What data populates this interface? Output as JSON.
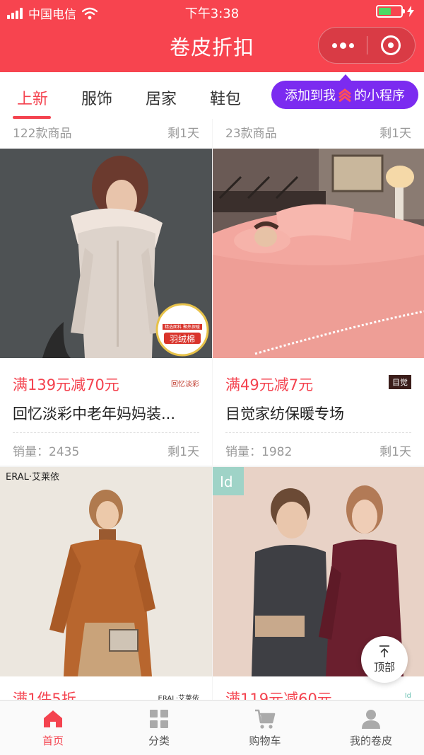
{
  "status_bar": {
    "carrier": "中国电信",
    "time": "下午3:38"
  },
  "header": {
    "title": "卷皮折扣"
  },
  "tabs": [
    {
      "label": "上新",
      "active": true
    },
    {
      "label": "服饰",
      "active": false
    },
    {
      "label": "居家",
      "active": false
    },
    {
      "label": "鞋包",
      "active": false
    }
  ],
  "tooltip": {
    "before": "添加到我",
    "after": "的小程序"
  },
  "products": [
    {
      "count": "122款商品",
      "remaining": "剩1天",
      "deal": "满139元减70元",
      "brand": "回忆淡彩",
      "name": "回忆淡彩中老年妈妈装...",
      "sales": "销量：2435",
      "days": "剩1天",
      "badge": [
        "精选面料 聚热保暖",
        "羽绒棉"
      ]
    },
    {
      "count": "23款商品",
      "remaining": "剩1天",
      "deal": "满49元减7元",
      "brand": "目觉",
      "name": "目觉家纺保暖专场",
      "sales": "销量：1982",
      "days": "剩1天"
    },
    {
      "deal": "满1件5折",
      "brand": "ERAL·艾莱依",
      "logo_text": "ERAL·艾莱依"
    },
    {
      "deal": "满119元减60元",
      "brand": "Id",
      "logo_text": "Id"
    }
  ],
  "top_button": {
    "label": "顶部"
  },
  "bottom_nav": [
    {
      "label": "首页",
      "icon": "home-icon",
      "active": true
    },
    {
      "label": "分类",
      "icon": "grid-icon",
      "active": false
    },
    {
      "label": "购物车",
      "icon": "cart-icon",
      "active": false
    },
    {
      "label": "我的卷皮",
      "icon": "user-icon",
      "active": false
    }
  ],
  "colors": {
    "brand_red": "#f7444f",
    "accent_red": "#f4434f",
    "tooltip_purple": "#7b2bf0",
    "battery_green": "#4cd964"
  }
}
